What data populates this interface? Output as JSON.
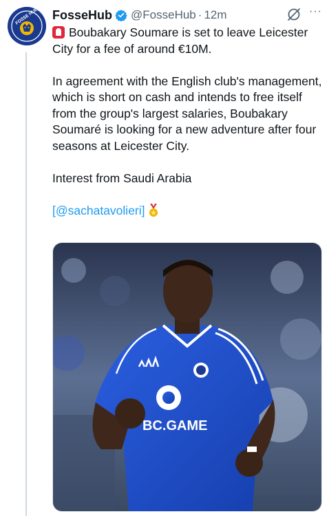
{
  "tweet": {
    "author_name": "FosseHub",
    "handle": "@FosseHub",
    "separator": "·",
    "time": "12m",
    "more": "···",
    "avatar_text": "FOSSE HUB",
    "paragraphs": [
      "Boubakary Soumare is set to leave Leicester City for a fee of around €10M.",
      "In agreement with the English club's management, which is short on cash and intends to free itself from the group's largest salaries, Boubakary Soumaré is looking for a new adventure after four seasons at Leicester City.",
      "Interest from Saudi Arabia"
    ],
    "source_open": "[",
    "source_mention": "@sachatavolieri",
    "source_close": "]",
    "jersey_sponsor": "BC.GAME"
  },
  "colors": {
    "accent": "#1d9bf0",
    "text": "#0f1419",
    "secondary": "#536471",
    "alert": "#e0283c",
    "jersey_blue": "#1f4fd1"
  },
  "icons": [
    "verified-badge-icon",
    "grok-icon",
    "more-icon",
    "alert-light-icon",
    "medal-icon"
  ]
}
